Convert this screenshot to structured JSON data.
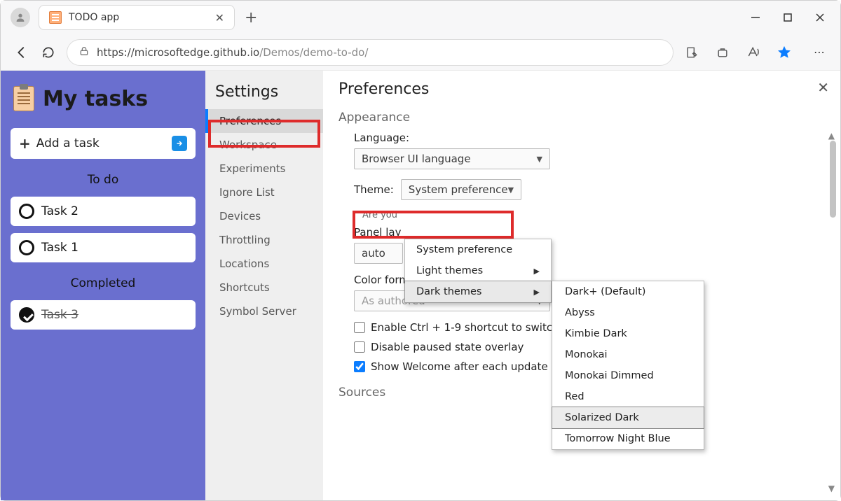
{
  "tab": {
    "title": "TODO app"
  },
  "url": {
    "host": "https://microsoftedge.github.io",
    "path": "/Demos/demo-to-do/"
  },
  "tasks": {
    "title": "My tasks",
    "add_label": "Add a task",
    "todo_head": "To do",
    "done_head": "Completed",
    "todo": [
      "Task 2",
      "Task 1"
    ],
    "done": [
      "Task 3"
    ]
  },
  "settings": {
    "title": "Settings",
    "items": [
      "Preferences",
      "Workspace",
      "Experiments",
      "Ignore List",
      "Devices",
      "Throttling",
      "Locations",
      "Shortcuts",
      "Symbol Server"
    ],
    "active": 0
  },
  "prefs": {
    "title": "Preferences",
    "appearance": "Appearance",
    "language_label": "Language:",
    "language_value": "Browser UI language",
    "theme_label": "Theme:",
    "theme_value": "System preference",
    "theme_sub": "Are you",
    "panel_label": "Panel lay",
    "panel_value": "auto",
    "colorfmt_label": "Color format:",
    "colorfmt_value": "As authored",
    "cb1": "Enable Ctrl + 1-9 shortcut to switc",
    "cb2": "Disable paused state overlay",
    "cb3": "Show Welcome after each update",
    "sources": "Sources"
  },
  "menu1": {
    "items": [
      "System preference",
      "Light themes",
      "Dark themes"
    ],
    "hover_index": 2,
    "submenu_from": 1
  },
  "menu2": {
    "items": [
      "Dark+ (Default)",
      "Abyss",
      "Kimbie Dark",
      "Monokai",
      "Monokai Dimmed",
      "Red",
      "Solarized Dark",
      "Tomorrow Night Blue"
    ],
    "selected_index": 6
  }
}
